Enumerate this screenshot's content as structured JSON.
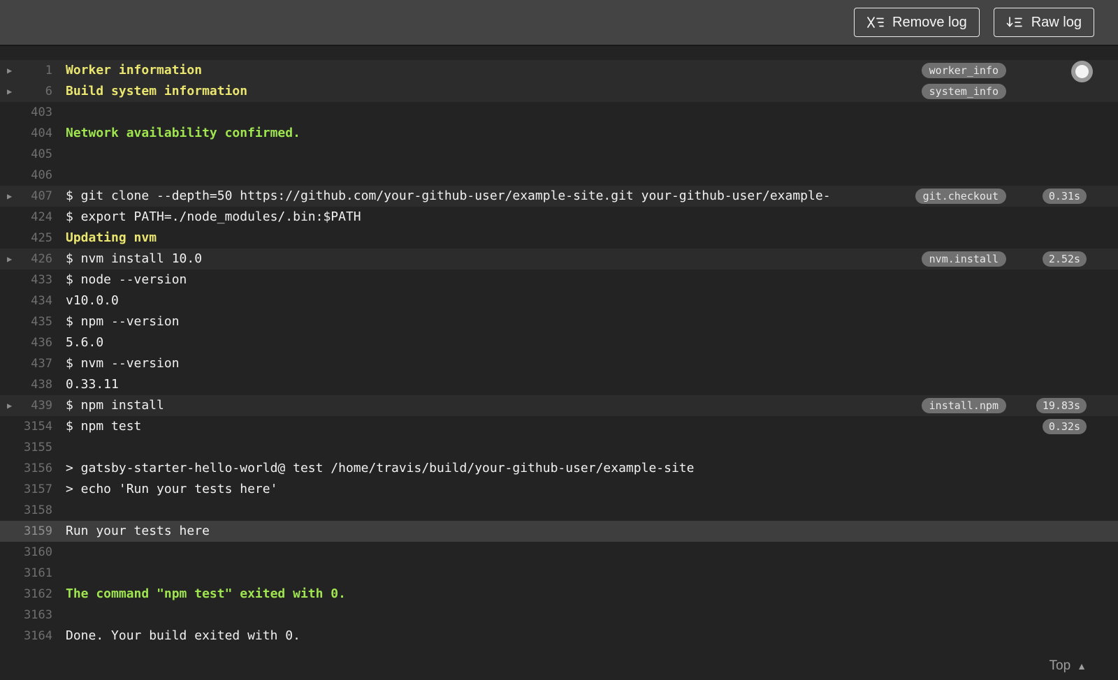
{
  "header": {
    "remove_log_label": "Remove log",
    "raw_log_label": "Raw log"
  },
  "footer": {
    "top_label": "Top"
  },
  "colors": {
    "header_bg": "#444444",
    "log_bg": "#232323",
    "fold_row_bg": "#2c2c2c",
    "highlight_row_bg": "#3e3e3e",
    "text": "#f1f1f1",
    "line_number": "#6f6f6f",
    "yellow": "#eae66f",
    "green": "#9fe54f",
    "badge_bg": "#707070"
  },
  "log": {
    "rows": [
      {
        "n": "1",
        "text": "Worker information",
        "color": "yellow",
        "fold": true,
        "tag": "worker_info"
      },
      {
        "n": "6",
        "text": "Build system information",
        "color": "yellow",
        "fold": true,
        "tag": "system_info"
      },
      {
        "n": "403",
        "text": ""
      },
      {
        "n": "404",
        "text": "Network availability confirmed.",
        "color": "green"
      },
      {
        "n": "405",
        "text": ""
      },
      {
        "n": "406",
        "text": ""
      },
      {
        "n": "407",
        "text": "$ git clone --depth=50 https://github.com/your-github-user/example-site.git your-github-user/example-",
        "fold": true,
        "tag": "git.checkout",
        "dur": "0.31s"
      },
      {
        "n": "424",
        "text": "$ export PATH=./node_modules/.bin:$PATH"
      },
      {
        "n": "425",
        "text": "Updating nvm",
        "color": "yellow"
      },
      {
        "n": "426",
        "text": "$ nvm install 10.0",
        "fold": true,
        "tag": "nvm.install",
        "dur": "2.52s"
      },
      {
        "n": "433",
        "text": "$ node --version"
      },
      {
        "n": "434",
        "text": "v10.0.0"
      },
      {
        "n": "435",
        "text": "$ npm --version"
      },
      {
        "n": "436",
        "text": "5.6.0"
      },
      {
        "n": "437",
        "text": "$ nvm --version"
      },
      {
        "n": "438",
        "text": "0.33.11"
      },
      {
        "n": "439",
        "text": "$ npm install",
        "fold": true,
        "tag": "install.npm",
        "dur": "19.83s"
      },
      {
        "n": "3154",
        "text": "$ npm test",
        "dur": "0.32s"
      },
      {
        "n": "3155",
        "text": ""
      },
      {
        "n": "3156",
        "text": "> gatsby-starter-hello-world@ test /home/travis/build/your-github-user/example-site"
      },
      {
        "n": "3157",
        "text": "> echo 'Run your tests here'"
      },
      {
        "n": "3158",
        "text": ""
      },
      {
        "n": "3159",
        "text": "Run your tests here",
        "highlight": true
      },
      {
        "n": "3160",
        "text": ""
      },
      {
        "n": "3161",
        "text": ""
      },
      {
        "n": "3162",
        "text": "The command \"npm test\" exited with 0.",
        "color": "green"
      },
      {
        "n": "3163",
        "text": ""
      },
      {
        "n": "3164",
        "text": "Done. Your build exited with 0."
      }
    ]
  }
}
